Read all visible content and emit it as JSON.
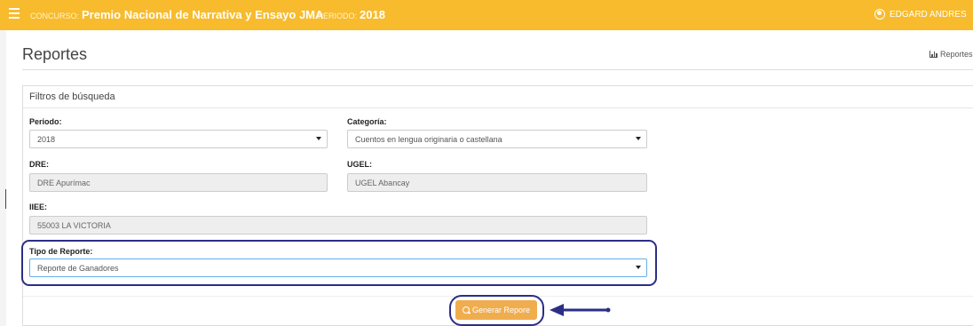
{
  "topbar": {
    "concurso_label": "Concurso:",
    "concurso_value": "Premio Nacional de Narrativa y Ensayo JMA",
    "periodo_label": "Periodo:",
    "periodo_value": "2018",
    "user_name": "EDGARD ANDRES"
  },
  "page": {
    "title": "Reportes",
    "breadcrumb": "Reportes"
  },
  "panel": {
    "heading": "Filtros de búsqueda"
  },
  "form": {
    "periodo": {
      "label": "Periodo:",
      "value": "2018"
    },
    "categoria": {
      "label": "Categoría:",
      "value": "Cuentos en lengua originaria o castellana"
    },
    "dre": {
      "label": "DRE:",
      "value": "DRE Apurímac"
    },
    "ugel": {
      "label": "UGEL:",
      "value": "UGEL Abancay"
    },
    "iiee": {
      "label": "IIEE:",
      "value": "55003 LA VICTORIA"
    },
    "tipo_reporte": {
      "label": "Tipo de Reporte:",
      "value": "Reporte de Ganadores"
    }
  },
  "actions": {
    "generate_label": "Generar Repore"
  },
  "colors": {
    "topbar": "#f7bb2d",
    "button": "#f0ad4e",
    "annotation": "#2c2e86"
  }
}
